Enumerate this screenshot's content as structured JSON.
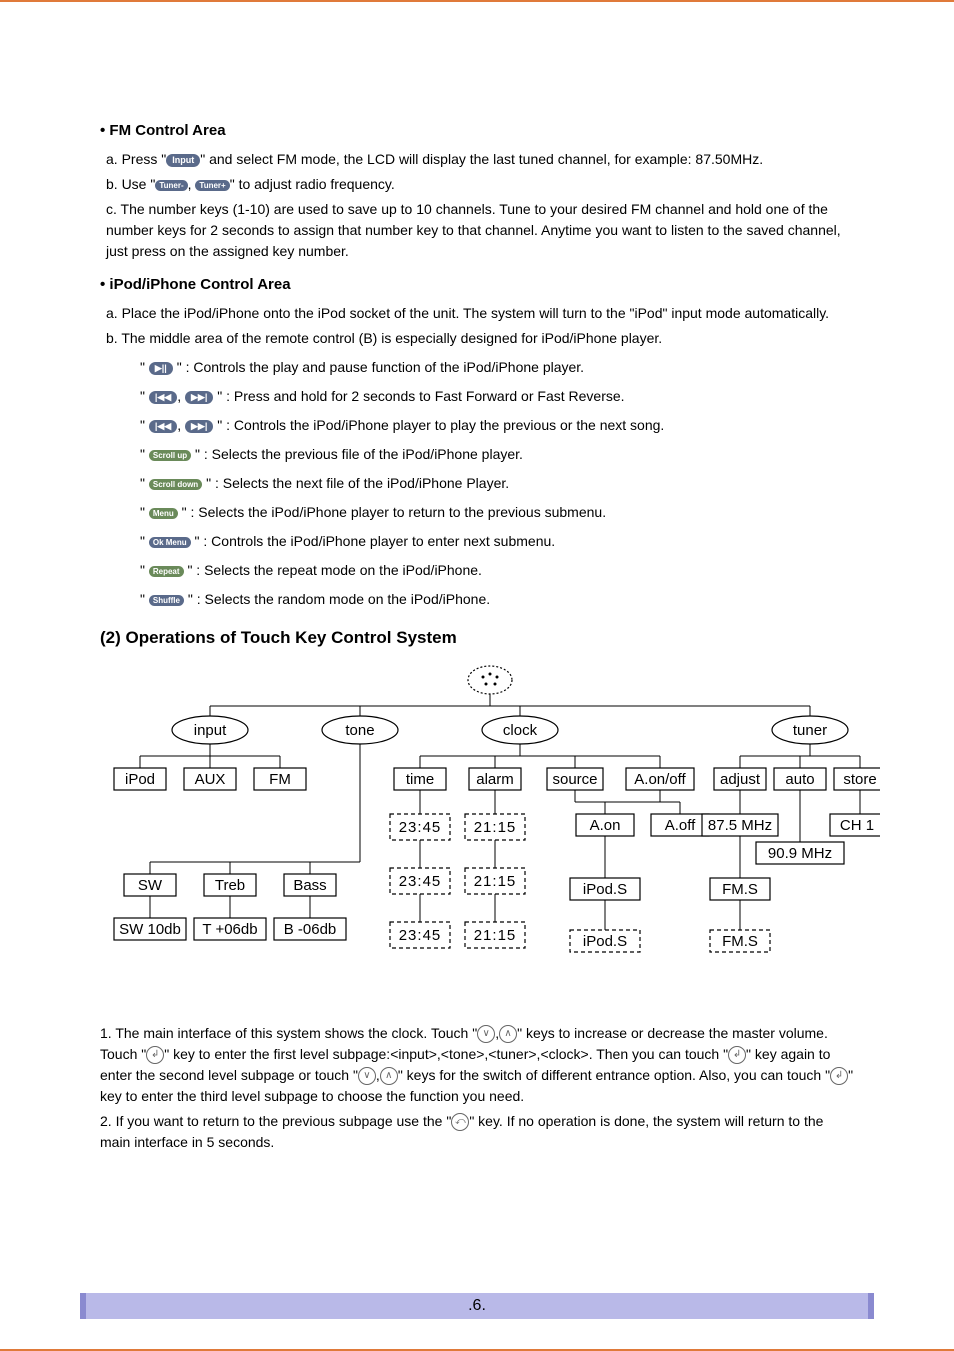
{
  "fm": {
    "heading": "FM Control Area",
    "a_prefix": "a. Press \"",
    "a_button": "Input",
    "a_suffix": "\" and select FM mode, the LCD will display the last tuned channel, for example: 87.50MHz.",
    "b_prefix": "b. Use \"",
    "b_btn1": "Tuner-",
    "b_sep": ", ",
    "b_btn2": "Tuner+",
    "b_suffix": "\" to adjust radio frequency.",
    "c": "c. The number keys (1-10) are used to save up to 10 channels. Tune to your desired FM channel and hold one of the number keys for 2 seconds to assign that number key to that channel. Anytime you want to listen to the saved channel, just press on the assigned key number."
  },
  "ipod": {
    "heading": "iPod/iPhone Control Area",
    "a": "a. Place the iPod/iPhone onto the iPod socket of the unit. The system will turn to the \"iPod\" input mode automatically.",
    "b": "b. The middle area of the remote control (B) is especially designed for iPod/iPhone player.",
    "items": [
      {
        "btn": "▶||",
        "btn2": "",
        "text": "\" : Controls the play and pause function of the iPod/iPhone player."
      },
      {
        "btn": "|◀◀",
        "btn2": "▶▶|",
        "text": "\" : Press and hold for 2 seconds to Fast Forward or Fast Reverse."
      },
      {
        "btn": "|◀◀",
        "btn2": "▶▶|",
        "text": "\" : Controls the iPod/iPhone player to play the previous or the next song."
      },
      {
        "btn": "Scroll up",
        "btn2": "",
        "text": "\" : Selects the previous file of the iPod/iPhone player."
      },
      {
        "btn": "Scroll down",
        "btn2": "",
        "text": "\" : Selects the next file of the iPod/iPhone Player."
      },
      {
        "btn": "Menu",
        "btn2": "",
        "text": "\" : Selects the iPod/iPhone player to return to the previous submenu."
      },
      {
        "btn": "Ok Menu",
        "btn2": "",
        "text": "\" : Controls the iPod/iPhone player to enter next submenu."
      },
      {
        "btn": "Repeat",
        "btn2": "",
        "text": "\" : Selects the repeat mode on the iPod/iPhone."
      },
      {
        "btn": "Shuffle",
        "btn2": "",
        "text": "\" : Selects the random mode on the iPod/iPhone."
      }
    ]
  },
  "touch": {
    "heading": "(2) Operations of Touch Key Control System",
    "p1": "1. The main interface of this system shows the clock.  Touch \"",
    "p1b": "\" keys to increase or decrease the master volume.  Touch \"",
    "p1c": "\" key to enter the first level subpage:<input>,<tone>,<tuner>,<clock>. Then you can touch \"",
    "p1d": "\" key again to enter the second level subpage or touch \"",
    "p1e": "\" keys for the switch of different entrance option. Also, you can touch \"",
    "p1f": "\" key to enter the third level subpage to choose the function you need.",
    "p2a": "2. If you want to return to the previous subpage use the \"",
    "p2b": "\" key. If no operation is done, the system will return to the main interface in 5 seconds."
  },
  "chart_data": {
    "type": "tree",
    "root": "(clock display)",
    "level1": [
      "input",
      "tone",
      "clock",
      "tuner"
    ],
    "input_children": [
      "iPod",
      "AUX",
      "FM"
    ],
    "tone_children": [
      "SW",
      "Treb",
      "Bass"
    ],
    "tone_values": [
      "SW 10db",
      "T +06db",
      "B -06db"
    ],
    "clock_children": [
      "time",
      "alarm",
      "source",
      "A.on/off"
    ],
    "time_values": [
      "23:45",
      "23:45",
      "23:45"
    ],
    "alarm_values": [
      "21:15",
      "21:15",
      "21:15"
    ],
    "source_children": [
      "iPod.S",
      "iPod.S"
    ],
    "aonoff_children": [
      "A.on",
      "A.off"
    ],
    "tuner_children": [
      "adjust",
      "auto",
      "store"
    ],
    "adjust_value": "87.5 MHz",
    "auto_value": "90.9 MHz",
    "store_value": "CH 1",
    "auto_children": [
      "FM.S",
      "FM.S"
    ]
  },
  "diagram": {
    "input": "input",
    "tone": "tone",
    "clock": "clock",
    "tuner": "tuner",
    "ipod": "iPod",
    "aux": "AUX",
    "fm": "FM",
    "sw": "SW",
    "treb": "Treb",
    "bass": "Bass",
    "sw10": "SW 10db",
    "t06": "T +06db",
    "b06": "B -06db",
    "time": "time",
    "alarm": "alarm",
    "source": "source",
    "aonoff": "A.on/off",
    "t2345a": "23:45",
    "t2115a": "21:15",
    "t2345b": "23:45",
    "t2115b": "21:15",
    "t2345c": "23:45",
    "t2115c": "21:15",
    "aon": "A.on",
    "aoff": "A.off",
    "ipods1": "iPod.S",
    "ipods2": "iPod.S",
    "adjust": "adjust",
    "auto": "auto",
    "store": "store",
    "f875": "87.5 MHz",
    "f909": "90.9 MHz",
    "ch1": "CH 1",
    "fms1": "FM.S",
    "fms2": "FM.S"
  },
  "footer": ".6."
}
